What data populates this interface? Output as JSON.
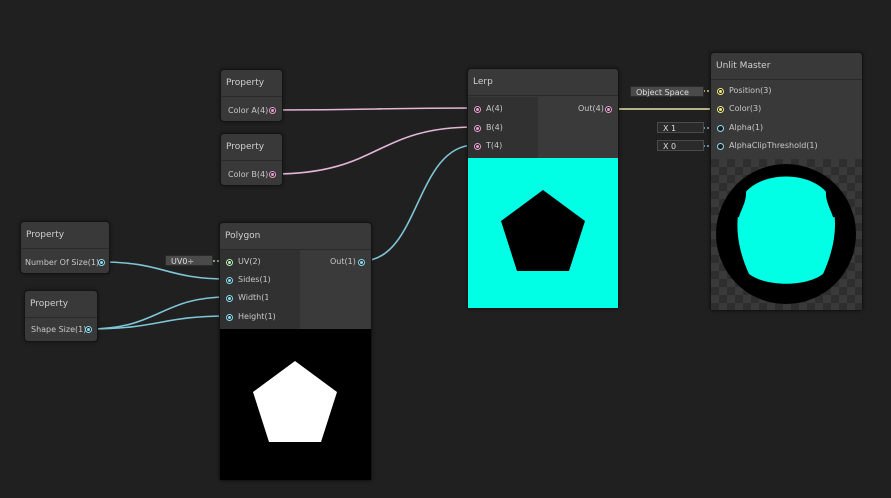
{
  "colors": {
    "background": "#202020",
    "wire_color": "#e3b6d8",
    "wire_vector": "#7fc5d6",
    "wire_vec2": "#b9eebd",
    "wire_vec3": "#f7f49a",
    "port_color": "#e8a0d0",
    "port_vector1": "#8cdcf0",
    "port_vec2": "#b9f0b9",
    "port_vec3": "#f0eb80",
    "cyan": "#00ffe5"
  },
  "nodes": {
    "color_a_prop": {
      "title": "Property",
      "output": "Color A(4)"
    },
    "color_b_prop": {
      "title": "Property",
      "output": "Color B(4)"
    },
    "num_sides_prop": {
      "title": "Property",
      "output": "Number Of Size(1)"
    },
    "shape_size_prop": {
      "title": "Property",
      "output": "Shape Size(1)"
    },
    "polygon": {
      "title": "Polygon",
      "inputs": [
        "UV(2)",
        "Sides(1)",
        "Width(1)",
        "Height(1)"
      ],
      "output": "Out(1)",
      "uv_field": "UV0"
    },
    "lerp": {
      "title": "Lerp",
      "inputs": [
        "A(4)",
        "B(4)",
        "T(4)"
      ],
      "output": "Out(4)"
    },
    "master": {
      "title": "Unlit Master",
      "inputs": [
        "Position(3)",
        "Color(3)",
        "Alpha(1)",
        "AlphaClipThreshold(1)"
      ],
      "position_field": "Object Space",
      "alpha_field": "X  1",
      "clip_field": "X  0"
    }
  }
}
